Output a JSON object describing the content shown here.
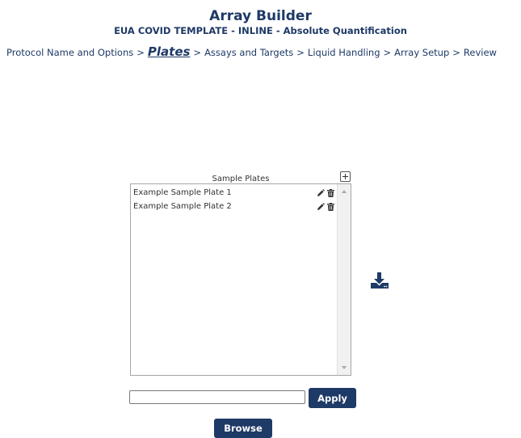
{
  "header": {
    "title": "Array Builder",
    "protocol_name": "EUA COVID TEMPLATE - INLINE - Absolute Quantification"
  },
  "breadcrumb": {
    "steps": [
      "Protocol Name and Options",
      "Plates",
      "Assays and Targets",
      "Liquid Handling",
      "Array Setup",
      "Review"
    ],
    "separator": ">",
    "active_step": "Plates"
  },
  "sample_plates": {
    "title": "Sample Plates",
    "add_icon": "plus-box-icon",
    "items": [
      {
        "label": "Example Sample Plate 1",
        "edit_icon": "pencil-icon",
        "delete_icon": "trash-icon"
      },
      {
        "label": "Example Sample Plate 2",
        "edit_icon": "pencil-icon",
        "delete_icon": "trash-icon"
      }
    ]
  },
  "download": {
    "icon": "download-icon"
  },
  "file_input": {
    "value": "",
    "placeholder": ""
  },
  "buttons": {
    "apply": "Apply",
    "browse": "Browse"
  },
  "colors": {
    "primary": "#1e3a66",
    "list_border": "#a6a6a6",
    "scrollbar": "#f1f1f1"
  }
}
